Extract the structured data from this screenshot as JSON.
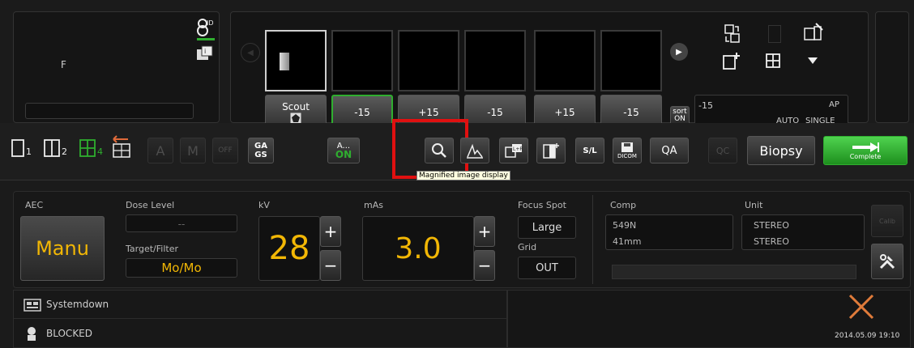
{
  "patient": {
    "sex": "F"
  },
  "thumbnails": [
    {
      "label": "Scout",
      "selected": true
    },
    {
      "label": "-15",
      "selected": false,
      "active": true
    },
    {
      "label": "+15",
      "selected": false
    },
    {
      "label": "-15",
      "selected": false
    },
    {
      "label": "+15",
      "selected": false
    },
    {
      "label": "-15",
      "selected": false
    }
  ],
  "sort": {
    "line1": "sort",
    "line2": "ON"
  },
  "view_info": {
    "angle": "-15",
    "position": "AP",
    "mode": "AUTO",
    "type": "SINGLE"
  },
  "toolbar": {
    "layout1_sub": "1",
    "layout2_sub": "2",
    "layout4_sub": "4",
    "gags_top": "GA",
    "gags_bottom": "GS",
    "aon_top": "A...",
    "aon_bottom": "ON",
    "off_label": "OFF",
    "sl_label": "S/L",
    "dicom_label": "DICOM",
    "qa_label": "QA",
    "qc_label": "QC",
    "biopsy_label": "Biopsy",
    "complete_label": "Complete",
    "tooltip": "Magnified image display"
  },
  "exposure": {
    "aec_label": "AEC",
    "aec_value": "Manu",
    "dose_label": "Dose Level",
    "dose_value": "--",
    "target_label": "Target/Filter",
    "target_value": "Mo/Mo",
    "kv_label": "kV",
    "kv_value": "28",
    "mas_label": "mAs",
    "mas_value": "3.0",
    "focus_label": "Focus Spot",
    "focus_value": "Large",
    "grid_label": "Grid",
    "grid_value": "OUT",
    "comp_label": "Comp",
    "comp_force": "549N",
    "comp_thickness": "41mm",
    "unit_label": "Unit",
    "unit_1": "STEREO",
    "unit_2": "STEREO",
    "calib_label": "Calib"
  },
  "status": {
    "systemdown": "Systemdown",
    "blocked": "BLOCKED",
    "datetime": "2014.05.09 19:10"
  },
  "colors": {
    "accent_green": "#2fae2f",
    "highlight_red": "#e01010",
    "value_yellow": "#f2b705"
  }
}
